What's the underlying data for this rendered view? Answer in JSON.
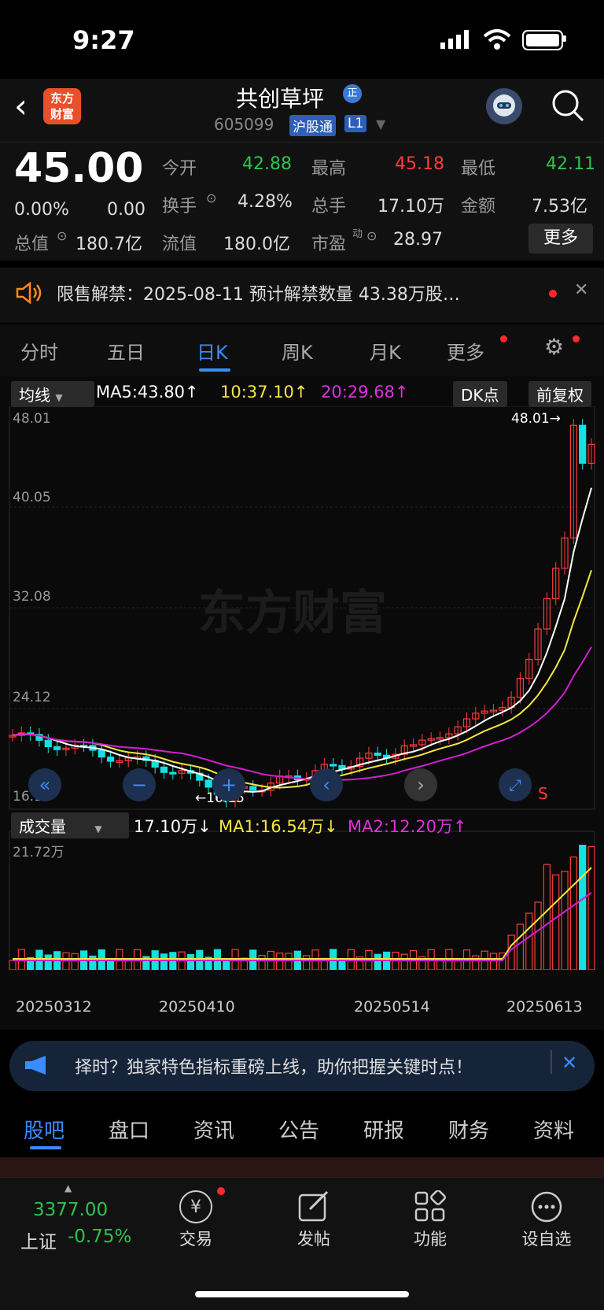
{
  "status": {
    "time": "9:27"
  },
  "header": {
    "name": "共创草坪",
    "code": "605099",
    "badge_hgt": "沪股通",
    "badge_l1": "L1",
    "zheng": "正",
    "logo_line1": "东方",
    "logo_line2": "财富"
  },
  "quote": {
    "price": "45.00",
    "change_pct": "0.00%",
    "change": "0.00",
    "open_label": "今开",
    "open": "42.88",
    "high_label": "最高",
    "high": "45.18",
    "low_label": "最低",
    "low": "42.11",
    "turnover_label": "换手",
    "turnover": "4.28%",
    "volume_label": "总手",
    "volume": "17.10万",
    "amount_label": "金额",
    "amount": "7.53亿",
    "mktcap_label": "总值",
    "mktcap": "180.7亿",
    "float_label": "流值",
    "float": "180.0亿",
    "pe_label": "市盈",
    "pe_sup": "动",
    "pe": "28.97",
    "more": "更多"
  },
  "notice": {
    "text": "限售解禁：2025-08-11 预计解禁数量 43.38万股…"
  },
  "ktabs": [
    "分时",
    "五日",
    "日K",
    "周K",
    "月K",
    "更多"
  ],
  "chart": {
    "ma_select": "均线",
    "ma5": "MA5:43.80↑",
    "ma10": "10:37.10↑",
    "ma20": "20:29.68↑",
    "dk": "DK点",
    "fq": "前复权",
    "y_labels": [
      "48.01",
      "40.05",
      "32.08",
      "24.12",
      "16.15"
    ],
    "max_marker": "48.01→",
    "min_marker": "←16.15",
    "sell_mark": "S",
    "watermark": "东方财富",
    "vol_select": "成交量",
    "vol_val": "17.10万↓",
    "vol_ma1": "MA1:16.54万↓",
    "vol_ma2": "MA2:12.20万↑",
    "vol_max": "21.72万",
    "dates": [
      "20250312",
      "20250410",
      "20250514",
      "20250613"
    ],
    "colors": {
      "up": "#ff3b3b",
      "down": "#16e0e0",
      "ma5": "#ffffff",
      "ma10": "#f5e642",
      "ma20": "#d01fd0"
    }
  },
  "banner": {
    "text": "择时？独家特色指标重磅上线，助你把握关键时点！"
  },
  "btabs": [
    "股吧",
    "盘口",
    "资讯",
    "公告",
    "研报",
    "财务",
    "资料"
  ],
  "bottom": {
    "index_val": "3377.00",
    "index_name": "上证",
    "index_chg": "-0.75%",
    "items": [
      "交易",
      "发帖",
      "功能",
      "设自选"
    ]
  }
}
